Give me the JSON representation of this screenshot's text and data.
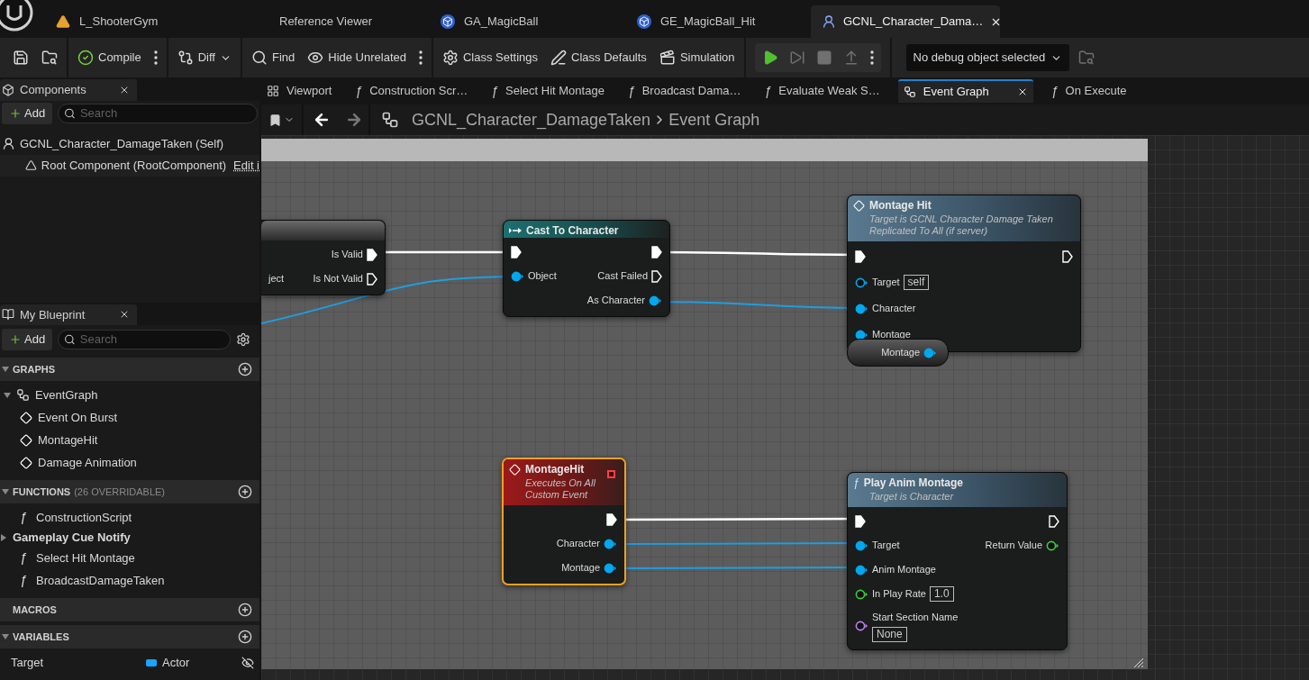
{
  "app_tabs": [
    {
      "label": "L_ShooterGym",
      "kind": "level",
      "selected": false,
      "closable": false
    },
    {
      "label": "Reference Viewer",
      "kind": "plain",
      "selected": false,
      "closable": false
    },
    {
      "label": "GA_MagicBall",
      "kind": "blueprint",
      "selected": false,
      "closable": false
    },
    {
      "label": "GE_MagicBall_Hit",
      "kind": "blueprint",
      "selected": false,
      "closable": false
    },
    {
      "label": "GCNL_Character_Dama…",
      "kind": "cue",
      "selected": true,
      "closable": true
    }
  ],
  "toolbar": [
    [
      {
        "kind": "save"
      },
      {
        "kind": "browse"
      }
    ],
    [
      {
        "kind": "compile",
        "label": "Compile"
      },
      {
        "kind": "more"
      }
    ],
    [
      {
        "kind": "diff",
        "label": "Diff"
      }
    ],
    [
      {
        "kind": "find",
        "label": "Find"
      },
      {
        "kind": "hide",
        "label": "Hide Unrelated"
      },
      {
        "kind": "more"
      }
    ],
    [
      {
        "kind": "settings",
        "label": "Class Settings"
      },
      {
        "kind": "defaults",
        "label": "Class Defaults"
      },
      {
        "kind": "simulation",
        "label": "Simulation"
      }
    ]
  ],
  "play_controls": [
    {
      "kind": "play",
      "disabled": false
    },
    {
      "kind": "step",
      "disabled": true
    },
    {
      "kind": "stop",
      "disabled": true
    },
    {
      "kind": "eject",
      "disabled": true
    },
    {
      "kind": "more",
      "disabled": false
    }
  ],
  "debug_select": {
    "value": "No debug object selected"
  },
  "components": {
    "title": "Components",
    "add": "Add",
    "search": {
      "placeholder": "Search"
    },
    "tree": [
      {
        "label": "GCNL_Character_DamageTaken (Self)",
        "kind": "self",
        "children": [
          {
            "label": "Root Component (RootComponent)",
            "kind": "scene",
            "link": "Edit i"
          }
        ]
      }
    ]
  },
  "graph_tabs": [
    {
      "label": "Viewport",
      "kind": "viewport",
      "selected": false
    },
    {
      "label": "Construction Scr…",
      "kind": "function",
      "glyph": "ƒ",
      "selected": false
    },
    {
      "label": "Select Hit Montage",
      "kind": "function",
      "glyph": "ƒ",
      "selected": false
    },
    {
      "label": "Broadcast Dama…",
      "kind": "function",
      "glyph": "ƒ",
      "selected": false
    },
    {
      "label": "Evaluate Weak S…",
      "kind": "function",
      "glyph": "ƒ",
      "selected": false
    },
    {
      "label": "Event Graph",
      "kind": "graph",
      "selected": true
    },
    {
      "label": "On Execute",
      "kind": "function",
      "glyph": "ƒ",
      "selected": false
    }
  ],
  "breadcrumb": [
    "GCNL_Character_DamageTaken",
    "Event Graph"
  ],
  "my_blueprint": {
    "title": "My Blueprint",
    "add": "Add",
    "search": {
      "placeholder": "Search"
    },
    "sections": [
      {
        "title": "GRAPHS",
        "expanded": true,
        "items": [
          {
            "label": "EventGraph",
            "kind": "graph",
            "expanded": true,
            "children": [
              {
                "label": "Event On Burst",
                "kind": "event"
              },
              {
                "label": "MontageHit",
                "kind": "event"
              },
              {
                "label": "Damage Animation",
                "kind": "event"
              }
            ]
          }
        ]
      },
      {
        "title": "FUNCTIONS",
        "note": "(26 OVERRIDABLE)",
        "expanded": true,
        "items": [
          {
            "label": "ConstructionScript",
            "kind": "function",
            "glyph": "ƒ"
          },
          {
            "label": "Gameplay Cue Notify",
            "kind": "category",
            "expanded": false
          },
          {
            "label": "Select Hit Montage",
            "kind": "function",
            "glyph": "ƒ"
          },
          {
            "label": "BroadcastDamageTaken",
            "kind": "function",
            "glyph": "ƒ"
          }
        ]
      },
      {
        "title": "MACROS"
      },
      {
        "title": "VARIABLES",
        "expanded": true,
        "items": [
          {
            "label": "Target",
            "kind": "variable",
            "type": "Actor"
          }
        ]
      }
    ]
  },
  "graph": {
    "nodes": [
      {
        "kind": "partial",
        "selected": false,
        "rows": [
          {
            "out": {
              "label": "Is Valid",
              "kind": "exec",
              "connected": true
            }
          },
          {
            "in": {
              "label": "ject"
            },
            "out": {
              "label": "Is Not Valid",
              "kind": "exec",
              "connected": false
            }
          }
        ]
      },
      {
        "kind": "cast",
        "title": "Cast To Character",
        "selected": false,
        "rows": [
          {
            "in": {
              "kind": "exec",
              "connected": true
            },
            "out": {
              "kind": "exec",
              "connected": true
            }
          },
          {
            "in": {
              "label": "Object",
              "kind": "object",
              "connected": true
            },
            "out": {
              "label": "Cast Failed",
              "kind": "exec",
              "connected": false
            }
          },
          {
            "out": {
              "label": "As Character",
              "kind": "object",
              "connected": true
            }
          }
        ]
      },
      {
        "kind": "event_call",
        "title": "Montage Hit",
        "subtitle_lines": [
          "Target is GCNL Character Damage Taken",
          "Replicated To All (if server)"
        ],
        "selected": false,
        "rows": [
          {
            "in": {
              "kind": "exec",
              "connected": true
            },
            "out": {
              "kind": "exec",
              "connected": false
            }
          },
          {
            "in": {
              "label": "Target",
              "kind": "self",
              "connected": false,
              "value": "self"
            }
          },
          {
            "in": {
              "label": "Character",
              "kind": "object",
              "connected": true
            }
          },
          {
            "in": {
              "label": "Montage",
              "kind": "object",
              "connected": true
            }
          }
        ]
      },
      {
        "kind": "variable",
        "selected": false,
        "rows": [
          {
            "out": {
              "label": "Montage",
              "kind": "object",
              "connected": true
            }
          }
        ]
      },
      {
        "kind": "event",
        "title": "MontageHit",
        "subtitle_lines": [
          "Executes On All",
          "Custom Event"
        ],
        "replicated": true,
        "selected": true,
        "rows": [
          {
            "out": {
              "kind": "exec",
              "connected": true
            }
          },
          {
            "out": {
              "label": "Character",
              "kind": "object",
              "connected": true
            }
          },
          {
            "out": {
              "label": "Montage",
              "kind": "object",
              "connected": true
            }
          }
        ]
      },
      {
        "kind": "function",
        "glyph": "ƒ",
        "title": "Play Anim Montage",
        "subtitle_lines": [
          "Target is Character"
        ],
        "selected": false,
        "rows": [
          {
            "in": {
              "kind": "exec",
              "connected": true
            },
            "out": {
              "kind": "exec",
              "connected": false
            }
          },
          {
            "in": {
              "label": "Target",
              "kind": "object",
              "connected": true
            },
            "out": {
              "label": "Return Value",
              "kind": "float",
              "connected": false
            }
          },
          {
            "in": {
              "label": "Anim Montage",
              "kind": "object",
              "connected": true
            }
          },
          {
            "in": {
              "label": "In Play Rate",
              "kind": "float",
              "connected": false,
              "value": "1.0"
            }
          },
          {
            "in": {
              "label": "Start Section Name",
              "kind": "name",
              "connected": false,
              "value": "None"
            }
          }
        ]
      }
    ]
  }
}
